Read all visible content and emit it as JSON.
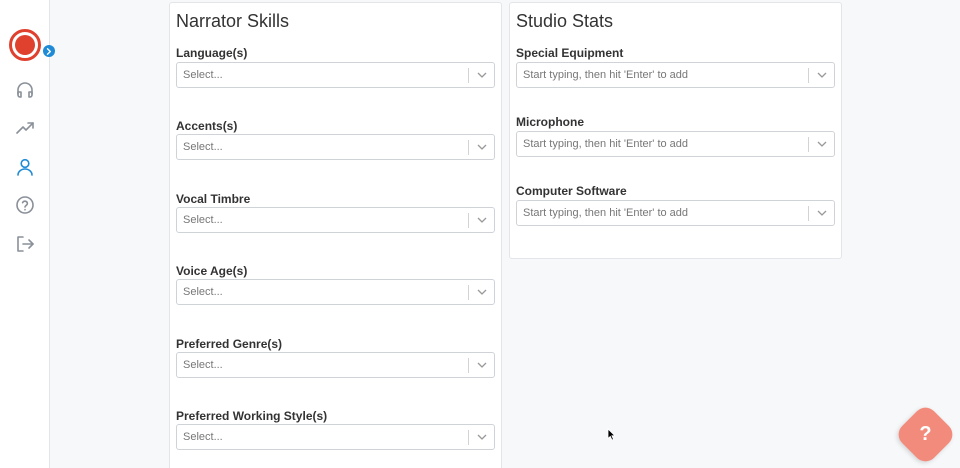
{
  "sidebar": {
    "nav": [
      {
        "name": "headphones-icon"
      },
      {
        "name": "trending-up-icon"
      },
      {
        "name": "user-icon"
      },
      {
        "name": "help-circle-icon"
      },
      {
        "name": "logout-icon"
      }
    ]
  },
  "narrator_skills": {
    "title": "Narrator Skills",
    "fields": [
      {
        "label": "Language(s)",
        "placeholder": "Select..."
      },
      {
        "label": "Accents(s)",
        "placeholder": "Select..."
      },
      {
        "label": "Vocal Timbre",
        "placeholder": "Select..."
      },
      {
        "label": "Voice Age(s)",
        "placeholder": "Select..."
      },
      {
        "label": "Preferred Genre(s)",
        "placeholder": "Select..."
      },
      {
        "label": "Preferred Working Style(s)",
        "placeholder": "Select..."
      }
    ]
  },
  "studio_stats": {
    "title": "Studio Stats",
    "fields": [
      {
        "label": "Special Equipment",
        "placeholder": "Start typing, then hit 'Enter' to add"
      },
      {
        "label": "Microphone",
        "placeholder": "Start typing, then hit 'Enter' to add"
      },
      {
        "label": "Computer Software",
        "placeholder": "Start typing, then hit 'Enter' to add"
      }
    ]
  },
  "help_fab": {
    "label": "?"
  },
  "colors": {
    "brand": "#e0402e",
    "accent": "#1f8bd6",
    "fab": "#f28b7c"
  }
}
